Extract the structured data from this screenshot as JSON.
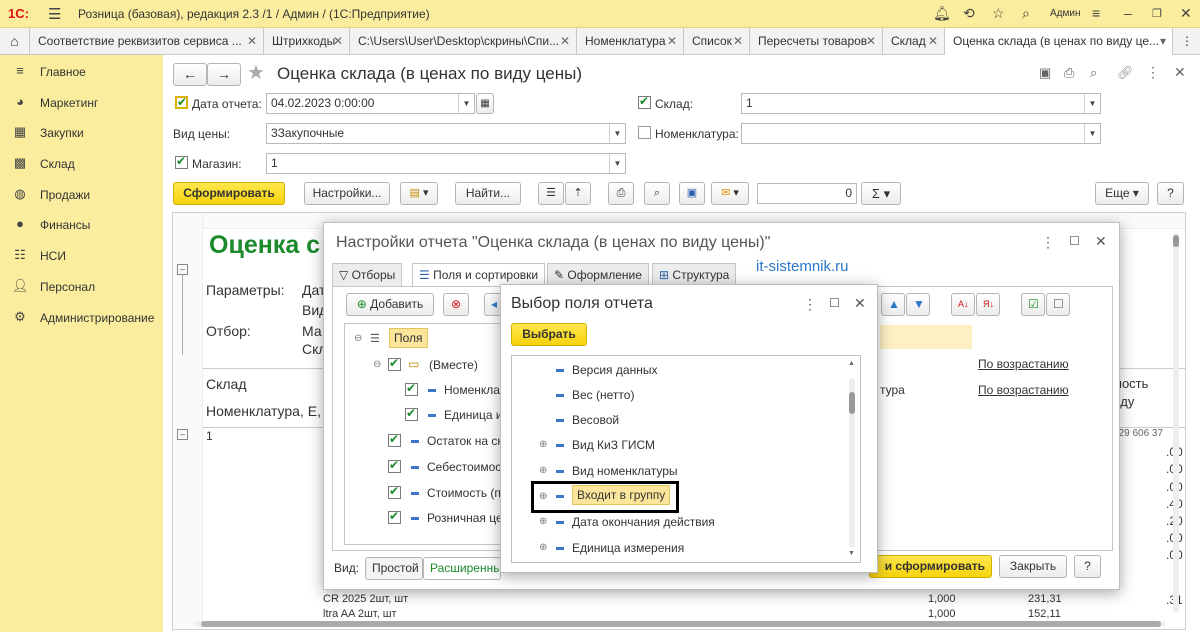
{
  "app": {
    "logo": "1С:",
    "title": "Розница (базовая), редакция 2.3 /1 / Админ /  (1С:Предприятие)",
    "user": "Админ"
  },
  "tabs": [
    {
      "label": "Соответствие реквизитов сервиса ..."
    },
    {
      "label": "Штрихкоды"
    },
    {
      "label": "C:\\Users\\User\\Desktop\\скрины\\Спи..."
    },
    {
      "label": "Номенклатура"
    },
    {
      "label": "Список"
    },
    {
      "label": "Пересчеты товаров"
    },
    {
      "label": "Склад"
    },
    {
      "label": "Оценка склада (в ценах по виду це..."
    }
  ],
  "sidebar": {
    "items": [
      {
        "label": "Главное",
        "icon": "menu-icon"
      },
      {
        "label": "Маркетинг",
        "icon": "pie-icon"
      },
      {
        "label": "Закупки",
        "icon": "cart-icon"
      },
      {
        "label": "Склад",
        "icon": "grid-icon"
      },
      {
        "label": "Продажи",
        "icon": "bag-icon"
      },
      {
        "label": "Финансы",
        "icon": "coin-icon"
      },
      {
        "label": "НСИ",
        "icon": "list-icon"
      },
      {
        "label": "Персонал",
        "icon": "person-icon"
      },
      {
        "label": "Администрирование",
        "icon": "gear-icon"
      }
    ]
  },
  "form": {
    "title": "Оценка склада (в ценах по виду цены)",
    "date_label": "Дата отчета:",
    "date_value": "04.02.2023  0:00:00",
    "sklad_label": "Склад:",
    "sklad_value": "1",
    "price_type_label": "Вид цены:",
    "price_type_value": "3Закупочные",
    "nomenclature_label": "Номенклатура:",
    "nomenclature_value": "",
    "shop_label": "Магазин:",
    "shop_value": "1",
    "generate": "Сформировать",
    "settings": "Настройки...",
    "find": "Найти...",
    "counter_value": "0",
    "sum_symbol": "Σ",
    "more": "Еще",
    "help": "?"
  },
  "report": {
    "title": "Оценка с",
    "params_label": "Параметры:",
    "params_v1": "Дат",
    "params_v2": "Вид",
    "filter_label": "Отбор:",
    "filter_v1": "Ма",
    "filter_v2": "Скл",
    "col_sklad": "Склад",
    "col_nom": "Номенклатура, Е,",
    "row_1": "1",
    "col_right_1": "мость",
    "col_right_2": "иду",
    "right_vals": [
      ".00",
      ".00",
      ".00",
      ".40",
      ".20",
      ".00",
      ".00",
      ".31"
    ],
    "right_top": "729 606 37",
    "bottom_row1_name": "CR 2025 2шт, шт",
    "bottom_row1_qty": "1,000",
    "bottom_row1_sum": "231,31",
    "bottom_row2_name": "ltra AA 2шт, шт",
    "bottom_row2_qty": "1,000",
    "bottom_row2_sum": "152,11"
  },
  "settings_dialog": {
    "title": "Настройки отчета \"Оценка склада (в ценах по виду цены)\"",
    "tabs": [
      "Отборы",
      "Поля и сортировки",
      "Оформление",
      "Структура"
    ],
    "add": "Добавить",
    "tree": [
      {
        "label": "Поля"
      },
      {
        "label": "(Вместе)"
      },
      {
        "label": "Номенкла"
      },
      {
        "label": "Единица и"
      },
      {
        "label": "Остаток на ск"
      },
      {
        "label": "Себестоимос"
      },
      {
        "label": "Стоимость (п"
      },
      {
        "label": "Розничная це"
      }
    ],
    "sort_1": "По возрастанию",
    "sort_2": "По возрастанию",
    "col_fragment": "тура",
    "view_label": "Вид:",
    "view_simple": "Простой",
    "view_advanced": "Расширенны",
    "apply_generate": "и сформировать",
    "close": "Закрыть",
    "help": "?"
  },
  "watermark": "it-sistemnik.ru",
  "field_dialog": {
    "title": "Выбор поля отчета",
    "select": "Выбрать",
    "fields": [
      {
        "label": "Версия данных",
        "expandable": false
      },
      {
        "label": "Вес (нетто)",
        "expandable": false
      },
      {
        "label": "Весовой",
        "expandable": false
      },
      {
        "label": "Вид КиЗ ГИСМ",
        "expandable": true
      },
      {
        "label": "Вид номенклатуры",
        "expandable": true
      },
      {
        "label": "Входит в группу",
        "expandable": true
      },
      {
        "label": "Дата окончания действия",
        "expandable": true
      },
      {
        "label": "Единица измерения",
        "expandable": true
      }
    ]
  },
  "colors": {
    "sidebar_bg": "#fbed9e",
    "accent_yellow": "#f6d30d",
    "title_green": "#1a8a2a",
    "watermark_blue": "#2a78c8"
  }
}
